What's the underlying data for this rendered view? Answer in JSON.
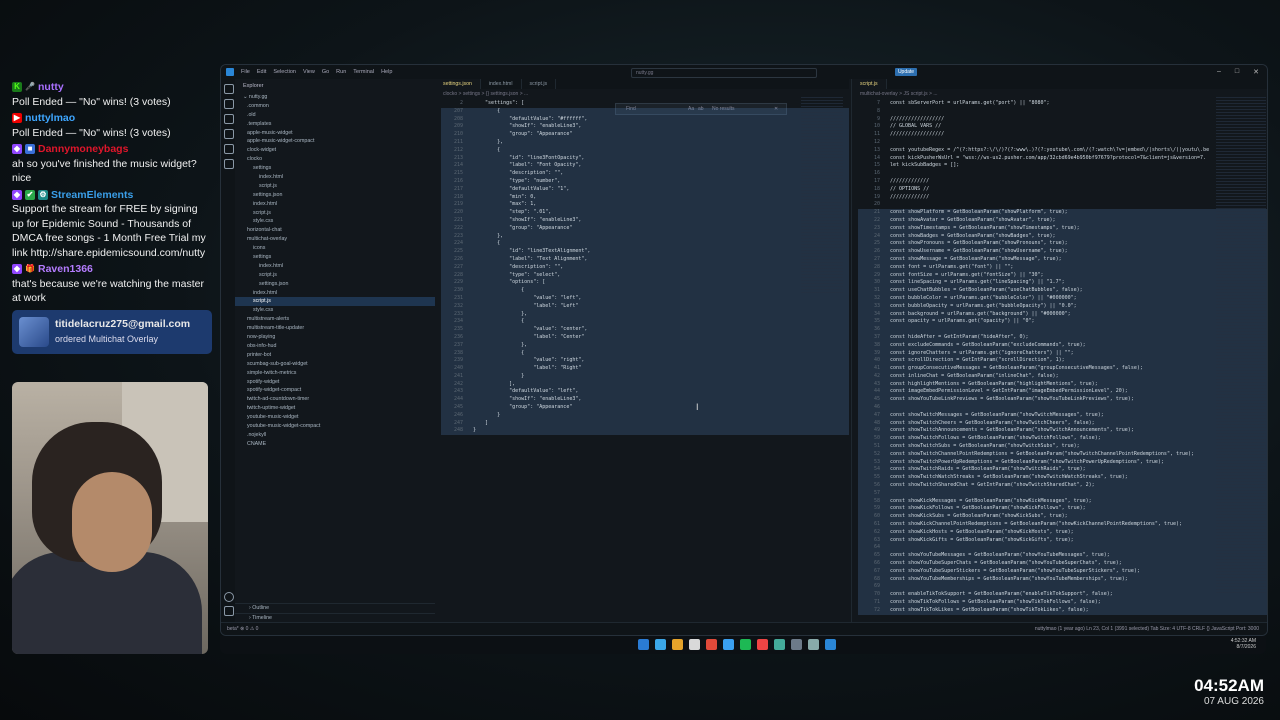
{
  "chat": {
    "messages": [
      {
        "user": "nutty",
        "user_color": "#a970ff",
        "text": "Poll Ended — \"No\" wins! (3 votes)",
        "badges": [
          "K",
          "mic-icon"
        ]
      },
      {
        "user": "nuttylmao",
        "user_color": "#3ea6ff",
        "text": "Poll Ended — \"No\" wins! (3 votes)",
        "badges": [
          "youtube-icon"
        ]
      },
      {
        "user": "Dannymoneybags",
        "user_color": "#e0162b",
        "text": "ah so you've finished the music widget? nice",
        "badges": [
          "twitch-icon",
          "badge-icon"
        ]
      },
      {
        "user": "StreamElements",
        "user_color": "#3a9ee8",
        "text": "Support the stream for FREE by signing up for Epidemic Sound - Thousands of DMCA free songs - 1 Month Free Trial my link http://share.epidemicsound.com/nutty",
        "badges": [
          "twitch-icon",
          "check-icon",
          "bot-icon"
        ]
      },
      {
        "user": "Raven1366",
        "user_color": "#b57cff",
        "text": "that's because we're watching the master at work",
        "badges": [
          "twitch-icon",
          "gift-icon"
        ]
      }
    ],
    "order": {
      "email": "titidelacruz275@gmail.com",
      "text": "ordered Multichat Overlay"
    }
  },
  "clock": {
    "time": "04:52AM",
    "date": "07 AUG 2026"
  },
  "vscode": {
    "menu": [
      "File",
      "Edit",
      "Selection",
      "View",
      "Go",
      "Run",
      "Terminal",
      "Help"
    ],
    "command_center": "nutty.gg",
    "update_label": "Update",
    "explorer": {
      "title": "Explorer",
      "root": "nutty.gg",
      "items": [
        ".common",
        ".old",
        ".templates",
        "apple-music-widget",
        "apple-music-widget-compact",
        "clock-widget",
        "clocko",
        "settings",
        "index.html",
        "script.js",
        "settings.json",
        "index.html",
        "script.js",
        "style.css",
        "horizontal-chat",
        "multichat-overlay",
        "icons",
        "settings",
        "index.html",
        "script.js",
        "settings.json",
        "index.html",
        "script.js",
        "style.css",
        "multistream-alerts",
        "multistream-title-updater",
        "now-playing",
        "obs-info-hud",
        "printer-bot",
        "scumbag-sub-goal-widget",
        "simple-twitch-metrics",
        "spotify-widget",
        "spotify-widget-compact",
        "twitch-ad-countdown-timer",
        "twitch-uptime-widget",
        "youtube-music-widget",
        "youtube-music-widget-compact",
        ".nojekyll",
        "CNAME"
      ],
      "selected_index": 22,
      "outline_label": "Outline",
      "timeline_label": "Timeline"
    },
    "left_editor": {
      "tabs": [
        "settings.json",
        "index.html",
        "script.js"
      ],
      "active_tab": 0,
      "breadcrumb": "clocko > settings > {} settings.json > ...",
      "find_placeholder": "Find",
      "find_result": "No results",
      "lines": [
        {
          "n": "2",
          "t": "    \"settings\": ["
        },
        {
          "n": "207",
          "t": "        {"
        },
        {
          "n": "208",
          "t": "            \"defaultValue\": \"#ffffff\","
        },
        {
          "n": "209",
          "t": "            \"showIf\": \"enableLine3\","
        },
        {
          "n": "210",
          "t": "            \"group\": \"Appearance\""
        },
        {
          "n": "211",
          "t": "        },"
        },
        {
          "n": "212",
          "t": "        {"
        },
        {
          "n": "213",
          "t": "            \"id\": \"line3FontOpacity\","
        },
        {
          "n": "214",
          "t": "            \"label\": \"Font Opacity\","
        },
        {
          "n": "215",
          "t": "            \"description\": \"\","
        },
        {
          "n": "216",
          "t": "            \"type\": \"number\","
        },
        {
          "n": "217",
          "t": "            \"defaultValue\": \"1\","
        },
        {
          "n": "218",
          "t": "            \"min\": 0,"
        },
        {
          "n": "219",
          "t": "            \"max\": 1,"
        },
        {
          "n": "220",
          "t": "            \"step\": \".01\","
        },
        {
          "n": "221",
          "t": "            \"showIf\": \"enableLine3\","
        },
        {
          "n": "222",
          "t": "            \"group\": \"Appearance\""
        },
        {
          "n": "223",
          "t": "        },"
        },
        {
          "n": "224",
          "t": "        {"
        },
        {
          "n": "225",
          "t": "            \"id\": \"line3TextAlignment\","
        },
        {
          "n": "226",
          "t": "            \"label\": \"Text Alignment\","
        },
        {
          "n": "227",
          "t": "            \"description\": \"\","
        },
        {
          "n": "228",
          "t": "            \"type\": \"select\","
        },
        {
          "n": "229",
          "t": "            \"options\": ["
        },
        {
          "n": "230",
          "t": "                {"
        },
        {
          "n": "231",
          "t": "                    \"value\": \"left\","
        },
        {
          "n": "232",
          "t": "                    \"label\": \"Left\""
        },
        {
          "n": "233",
          "t": "                },"
        },
        {
          "n": "234",
          "t": "                {"
        },
        {
          "n": "235",
          "t": "                    \"value\": \"center\","
        },
        {
          "n": "236",
          "t": "                    \"label\": \"Center\""
        },
        {
          "n": "237",
          "t": "                },"
        },
        {
          "n": "238",
          "t": "                {"
        },
        {
          "n": "239",
          "t": "                    \"value\": \"right\","
        },
        {
          "n": "240",
          "t": "                    \"label\": \"Right\""
        },
        {
          "n": "241",
          "t": "                }"
        },
        {
          "n": "242",
          "t": "            ],"
        },
        {
          "n": "243",
          "t": "            \"defaultValue\": \"left\","
        },
        {
          "n": "244",
          "t": "            \"showIf\": \"enableLine3\","
        },
        {
          "n": "245",
          "t": "            \"group\": \"Appearance\""
        },
        {
          "n": "246",
          "t": "        }"
        },
        {
          "n": "247",
          "t": "    ]"
        },
        {
          "n": "248",
          "t": "}"
        }
      ]
    },
    "right_editor": {
      "tabs": [
        "script.js"
      ],
      "breadcrumb": "multichat-overlay > JS script.js > ...",
      "lines": [
        {
          "n": "7",
          "t": "const sbServerPort = urlParams.get(\"port\") || \"8080\";"
        },
        {
          "n": "8",
          "t": ""
        },
        {
          "n": "9",
          "t": "//////////////////"
        },
        {
          "n": "10",
          "t": "// GLOBAL VARS //"
        },
        {
          "n": "11",
          "t": "//////////////////"
        },
        {
          "n": "12",
          "t": ""
        },
        {
          "n": "13",
          "t": "const youtubeRegex = /^(?:https?:\\/\\/)?(?:www\\.)?(?:youtube\\.com\\/(?:watch\\?v=|embed\\/|shorts\\/)|youtu\\.be"
        },
        {
          "n": "14",
          "t": "const kickPusherWsUrl = \"wss://ws-us2.pusher.com/app/32cbd69e4b950bf97679?protocol=7&client=js&version=7."
        },
        {
          "n": "15",
          "t": "let kickSubBadges = [];"
        },
        {
          "n": "16",
          "t": ""
        },
        {
          "n": "17",
          "t": "/////////////"
        },
        {
          "n": "18",
          "t": "// OPTIONS //"
        },
        {
          "n": "19",
          "t": "/////////////"
        },
        {
          "n": "20",
          "t": ""
        },
        {
          "n": "21",
          "t": "const showPlatform = GetBooleanParam(\"showPlatform\", true);"
        },
        {
          "n": "22",
          "t": "const showAvatar = GetBooleanParam(\"showAvatar\", true);"
        },
        {
          "n": "23",
          "t": "const showTimestamps = GetBooleanParam(\"showTimestamps\", true);"
        },
        {
          "n": "24",
          "t": "const showBadges = GetBooleanParam(\"showBadges\", true);"
        },
        {
          "n": "25",
          "t": "const showPronouns = GetBooleanParam(\"showPronouns\", true);"
        },
        {
          "n": "26",
          "t": "const showUsername = GetBooleanParam(\"showUsername\", true);"
        },
        {
          "n": "27",
          "t": "const showMessage = GetBooleanParam(\"showMessage\", true);"
        },
        {
          "n": "28",
          "t": "const font = urlParams.get(\"font\") || \"\";"
        },
        {
          "n": "29",
          "t": "const fontSize = urlParams.get(\"fontSize\") || \"30\";"
        },
        {
          "n": "30",
          "t": "const lineSpacing = urlParams.get(\"lineSpacing\") || \"1.7\";"
        },
        {
          "n": "31",
          "t": "const useChatBubbles = GetBooleanParam(\"useChatBubbles\", false);"
        },
        {
          "n": "32",
          "t": "const bubbleColor = urlParams.get(\"bubbleColor\") || \"#000000\";"
        },
        {
          "n": "33",
          "t": "const bubbleOpacity = urlParams.get(\"bubbleOpacity\") || \"0.0\";"
        },
        {
          "n": "34",
          "t": "const background = urlParams.get(\"background\") || \"#000000\";"
        },
        {
          "n": "35",
          "t": "const opacity = urlParams.get(\"opacity\") || \"0\";"
        },
        {
          "n": "36",
          "t": ""
        },
        {
          "n": "37",
          "t": "const hideAfter = GetIntParam(\"hideAfter\", 0);"
        },
        {
          "n": "38",
          "t": "const excludeCommands = GetBooleanParam(\"excludeCommands\", true);"
        },
        {
          "n": "39",
          "t": "const ignoreChatters = urlParams.get(\"ignoreChatters\") || \"\";"
        },
        {
          "n": "40",
          "t": "const scrollDirection = GetIntParam(\"scrollDirection\", 1);"
        },
        {
          "n": "41",
          "t": "const groupConsecutiveMessages = GetBooleanParam(\"groupConsecutiveMessages\", false);"
        },
        {
          "n": "42",
          "t": "const inlineChat = GetBooleanParam(\"inlineChat\", false);"
        },
        {
          "n": "43",
          "t": "const highlightMentions = GetBooleanParam(\"highlightMentions\", true);"
        },
        {
          "n": "44",
          "t": "const imageEmbedPermissionLevel = GetIntParam(\"imageEmbedPermissionLevel\", 20);"
        },
        {
          "n": "45",
          "t": "const showYouTubeLinkPreviews = GetBooleanParam(\"showYouTubeLinkPreviews\", true);"
        },
        {
          "n": "46",
          "t": ""
        },
        {
          "n": "47",
          "t": "const showTwitchMessages = GetBooleanParam(\"showTwitchMessages\", true);"
        },
        {
          "n": "48",
          "t": "const showTwitchCheers = GetBooleanParam(\"showTwitchCheers\", false);"
        },
        {
          "n": "49",
          "t": "const showTwitchAnnouncements = GetBooleanParam(\"showTwitchAnnouncements\", true);"
        },
        {
          "n": "50",
          "t": "const showTwitchFollows = GetBooleanParam(\"showTwitchFollows\", false);"
        },
        {
          "n": "51",
          "t": "const showTwitchSubs = GetBooleanParam(\"showTwitchSubs\", true);"
        },
        {
          "n": "52",
          "t": "const showTwitchChannelPointRedemptions = GetBooleanParam(\"showTwitchChannelPointRedemptions\", true);"
        },
        {
          "n": "53",
          "t": "const showTwitchPowerUpRedemptions = GetBooleanParam(\"showTwitchPowerUpRedemptions\", true);"
        },
        {
          "n": "54",
          "t": "const showTwitchRaids = GetBooleanParam(\"showTwitchRaids\", true);"
        },
        {
          "n": "55",
          "t": "const showTwitchWatchStreaks = GetBooleanParam(\"showTwitchWatchStreaks\", true);"
        },
        {
          "n": "56",
          "t": "const showTwitchSharedChat = GetIntParam(\"showTwitchSharedChat\", 2);"
        },
        {
          "n": "57",
          "t": ""
        },
        {
          "n": "58",
          "t": "const showKickMessages = GetBooleanParam(\"showKickMessages\", true);"
        },
        {
          "n": "59",
          "t": "const showKickFollows = GetBooleanParam(\"showKickFollows\", true);"
        },
        {
          "n": "60",
          "t": "const showKickSubs = GetBooleanParam(\"showKickSubs\", true);"
        },
        {
          "n": "61",
          "t": "const showKickChannelPointRedemptions = GetBooleanParam(\"showKickChannelPointRedemptions\", true);"
        },
        {
          "n": "62",
          "t": "const showKickHosts = GetBooleanParam(\"showKickHosts\", true);"
        },
        {
          "n": "63",
          "t": "const showKickGifts = GetBooleanParam(\"showKickGifts\", true);"
        },
        {
          "n": "64",
          "t": ""
        },
        {
          "n": "65",
          "t": "const showYouTubeMessages = GetBooleanParam(\"showYouTubeMessages\", true);"
        },
        {
          "n": "66",
          "t": "const showYouTubeSuperChats = GetBooleanParam(\"showYouTubeSuperChats\", true);"
        },
        {
          "n": "67",
          "t": "const showYouTubeSuperStickers = GetBooleanParam(\"showYouTubeSuperStickers\", true);"
        },
        {
          "n": "68",
          "t": "const showYouTubeMemberships = GetBooleanParam(\"showYouTubeMemberships\", true);"
        },
        {
          "n": "69",
          "t": ""
        },
        {
          "n": "70",
          "t": "const enableTikTokSupport = GetBooleanParam(\"enableTikTokSupport\", false);"
        },
        {
          "n": "71",
          "t": "const showTikTokFollows = GetBooleanParam(\"showTikTokFollows\", false);"
        },
        {
          "n": "72",
          "t": "const showTikTokLikes = GetBooleanParam(\"showTikTokLikes\", false);"
        }
      ]
    },
    "statusbar": {
      "left": "beta*   ⊗ 0 ⚠ 0",
      "right": "nuttylmao (1 year ago)    Ln 23, Col 1 (3991 selected)    Tab Size: 4    UTF-8    CRLF    {} JavaScript    Port: 3000"
    }
  },
  "taskbar": {
    "time": "4:52:32 AM",
    "date": "8/7/2026"
  }
}
